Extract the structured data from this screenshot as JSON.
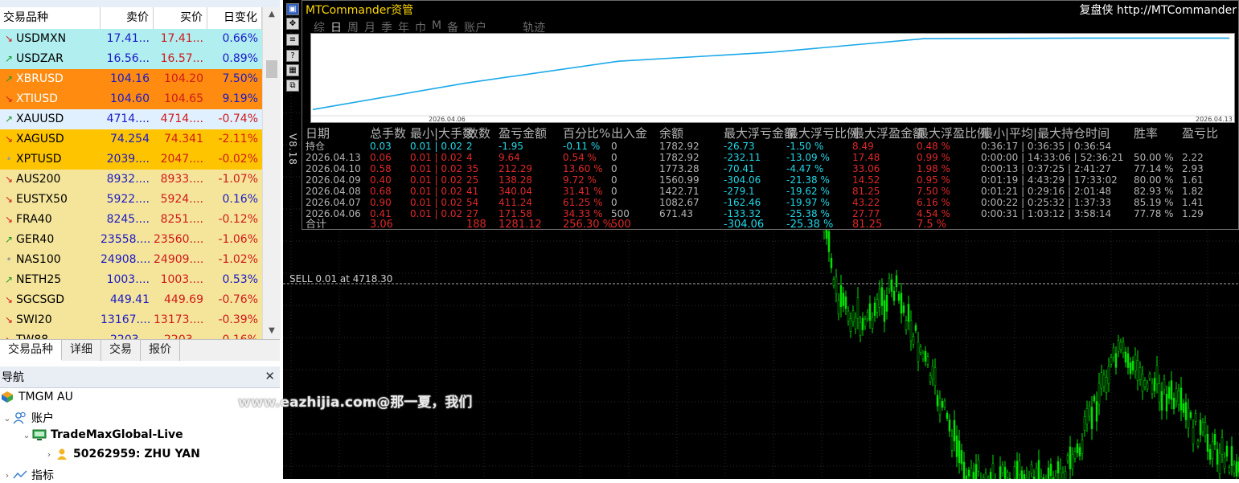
{
  "market_watch": {
    "headers": {
      "symbol": "交易品种",
      "bid": "卖价",
      "ask": "买价",
      "change": "日变化"
    },
    "rows": [
      {
        "symbol": "USDMXN",
        "bid": "17.41...",
        "ask": "17.41...",
        "change": "0.66%",
        "dir": "down",
        "bg": "#b0eef0",
        "neg": false
      },
      {
        "symbol": "USDZAR",
        "bid": "16.56...",
        "ask": "16.57...",
        "change": "0.89%",
        "dir": "up",
        "bg": "#b0eef0",
        "neg": false
      },
      {
        "symbol": "XBRUSD",
        "bid": "104.16",
        "ask": "104.20",
        "change": "7.50%",
        "dir": "up",
        "bg": "#ff8c10",
        "neg": false
      },
      {
        "symbol": "XTIUSD",
        "bid": "104.60",
        "ask": "104.65",
        "change": "9.19%",
        "dir": "down",
        "bg": "#ff8c10",
        "neg": false
      },
      {
        "symbol": "XAUUSD",
        "bid": "4714....",
        "ask": "4714....",
        "change": "-0.74%",
        "dir": "up",
        "bg": "#e0f0ff",
        "neg": true
      },
      {
        "symbol": "XAGUSD",
        "bid": "74.254",
        "ask": "74.341",
        "change": "-2.11%",
        "dir": "down",
        "bg": "#ffc400",
        "neg": true
      },
      {
        "symbol": "XPTUSD",
        "bid": "2039....",
        "ask": "2047....",
        "change": "-0.02%",
        "dir": "dot",
        "bg": "#ffc400",
        "neg": true
      },
      {
        "symbol": "AUS200",
        "bid": "8932....",
        "ask": "8933....",
        "change": "-1.07%",
        "dir": "down",
        "bg": "#f5e59a",
        "neg": true
      },
      {
        "symbol": "EUSTX50",
        "bid": "5922....",
        "ask": "5924....",
        "change": "0.16%",
        "dir": "down",
        "bg": "#f5e59a",
        "neg": false
      },
      {
        "symbol": "FRA40",
        "bid": "8245....",
        "ask": "8251....",
        "change": "-0.12%",
        "dir": "down",
        "bg": "#f5e59a",
        "neg": true
      },
      {
        "symbol": "GER40",
        "bid": "23558....",
        "ask": "23560....",
        "change": "-1.06%",
        "dir": "up",
        "bg": "#f5e59a",
        "neg": true
      },
      {
        "symbol": "NAS100",
        "bid": "24908....",
        "ask": "24909....",
        "change": "-1.02%",
        "dir": "dot",
        "bg": "#f5e59a",
        "neg": true
      },
      {
        "symbol": "NETH25",
        "bid": "1003....",
        "ask": "1003....",
        "change": "0.53%",
        "dir": "up",
        "bg": "#f5e59a",
        "neg": false
      },
      {
        "symbol": "SGCSGD",
        "bid": "449.41",
        "ask": "449.69",
        "change": "-0.76%",
        "dir": "down",
        "bg": "#f5e59a",
        "neg": true
      },
      {
        "symbol": "SWI20",
        "bid": "13167....",
        "ask": "13173....",
        "change": "-0.39%",
        "dir": "down",
        "bg": "#f5e59a",
        "neg": true
      },
      {
        "symbol": "TW88",
        "bid": "2203...",
        "ask": "2203...",
        "change": "-0.16%",
        "dir": "down",
        "bg": "#f5e59a",
        "neg": true
      }
    ],
    "tabs": [
      "交易品种",
      "详细",
      "交易",
      "报价"
    ]
  },
  "navigator": {
    "title": "导航",
    "broker": "TMGM AU",
    "accounts_label": "账户",
    "server": "TradeMaxGlobal-Live",
    "account": "50262959: ZHU YAN",
    "indicators_label": "指标"
  },
  "watermark": "www.eazhijia.com@那一夏，我们",
  "mtc": {
    "title": "MTCommander资管",
    "brand": "复盘侠 http://MTCommander",
    "menu": [
      "综",
      "日",
      "周",
      "月",
      "季",
      "年",
      "巾",
      "M",
      "备",
      "账户"
    ],
    "menu_active": "日",
    "traj": "轨迹",
    "version": "V8.18",
    "curve_start_date": "2026.04.06",
    "curve_end_date": "2026.04.13",
    "curve_balance": [
      671.43,
      1082.67,
      1422.71,
      1560.99,
      1773.28,
      1782.92,
      1782.92
    ],
    "headers": [
      "日期",
      "总手数",
      "最小|大手数",
      "数数",
      "盈亏金额",
      "百分比%",
      "出入金",
      "余额",
      "最大浮亏金额",
      "最大浮亏比例",
      "最大浮盈金额",
      "最大浮盈比例",
      "最小|平均|最大持仓时间",
      "胜率",
      "盈亏比"
    ],
    "holding": {
      "date": "持仓",
      "lots": "0.03",
      "minmax": "0.01 | 0.02",
      "count": "2",
      "pnl": "-1.95",
      "pct": "-0.11 %",
      "flow": "0",
      "balance": "1782.92",
      "maxloss": "-26.73",
      "maxlosspct": "-1.50 %",
      "maxgain": "8.49",
      "maxgainpct": "0.48 %",
      "time": "0:36:17 | 0:36:35 | 0:36:54",
      "win": "",
      "ratio": ""
    },
    "rows": [
      {
        "date": "2026.04.13",
        "lots": "0.06",
        "minmax": "0.01 | 0.02",
        "count": "4",
        "pnl": "9.64",
        "pct": "0.54 %",
        "flow": "0",
        "balance": "1782.92",
        "maxloss": "-232.11",
        "maxlosspct": "-13.09 %",
        "maxgain": "17.48",
        "maxgainpct": "0.99 %",
        "time": "0:00:00 | 14:33:06 | 52:36:21",
        "win": "50.00 %",
        "ratio": "2.22"
      },
      {
        "date": "2026.04.10",
        "lots": "0.58",
        "minmax": "0.01 | 0.02",
        "count": "35",
        "pnl": "212.29",
        "pct": "13.60 %",
        "flow": "0",
        "balance": "1773.28",
        "maxloss": "-70.41",
        "maxlosspct": "-4.47 %",
        "maxgain": "33.06",
        "maxgainpct": "1.98 %",
        "time": "0:00:13 | 0:37:25 | 2:41:27",
        "win": "77.14 %",
        "ratio": "2.93"
      },
      {
        "date": "2026.04.09",
        "lots": "0.40",
        "minmax": "0.01 | 0.02",
        "count": "25",
        "pnl": "138.28",
        "pct": "9.72 %",
        "flow": "0",
        "balance": "1560.99",
        "maxloss": "-304.06",
        "maxlosspct": "-21.38 %",
        "maxgain": "14.52",
        "maxgainpct": "0.95 %",
        "time": "0:01:19 | 4:43:29 | 17:33:02",
        "win": "80.00 %",
        "ratio": "1.61"
      },
      {
        "date": "2026.04.08",
        "lots": "0.68",
        "minmax": "0.01 | 0.02",
        "count": "41",
        "pnl": "340.04",
        "pct": "31.41 %",
        "flow": "0",
        "balance": "1422.71",
        "maxloss": "-279.1",
        "maxlosspct": "-19.62 %",
        "maxgain": "81.25",
        "maxgainpct": "7.50 %",
        "time": "0:01:21 | 0:29:16 | 2:01:48",
        "win": "82.93 %",
        "ratio": "1.82"
      },
      {
        "date": "2026.04.07",
        "lots": "0.90",
        "minmax": "0.01 | 0.02",
        "count": "54",
        "pnl": "411.24",
        "pct": "61.25 %",
        "flow": "0",
        "balance": "1082.67",
        "maxloss": "-162.46",
        "maxlosspct": "-19.97 %",
        "maxgain": "43.22",
        "maxgainpct": "6.16 %",
        "time": "0:00:22 | 0:25:32 | 1:37:33",
        "win": "85.19 %",
        "ratio": "1.41"
      },
      {
        "date": "2026.04.06",
        "lots": "0.41",
        "minmax": "0.01 | 0.02",
        "count": "27",
        "pnl": "171.58",
        "pct": "34.33 %",
        "flow": "500",
        "balance": "671.43",
        "maxloss": "-133.32",
        "maxlosspct": "-25.38 %",
        "maxgain": "27.77",
        "maxgainpct": "4.54 %",
        "time": "0:00:31 | 1:03:12 | 3:58:14",
        "win": "77.78 %",
        "ratio": "1.29"
      }
    ],
    "total": {
      "date": "合计",
      "lots": "3.06",
      "minmax": "",
      "count": "188",
      "pnl": "1281.12",
      "pct": "256.30 %",
      "flow": "500",
      "balance": "",
      "maxloss": "-304.06",
      "maxlosspct": "-25.38 %",
      "maxgain": "81.25",
      "maxgainpct": "7.5 %",
      "time": "",
      "win": "",
      "ratio": ""
    }
  },
  "order_line_label": "SELL 0.01 at 4718.30",
  "colors": {
    "up_arrow": "#1a9a2a",
    "down_arrow": "#d01a1a",
    "candle": "#00e000",
    "curve": "#1aa8e8"
  }
}
